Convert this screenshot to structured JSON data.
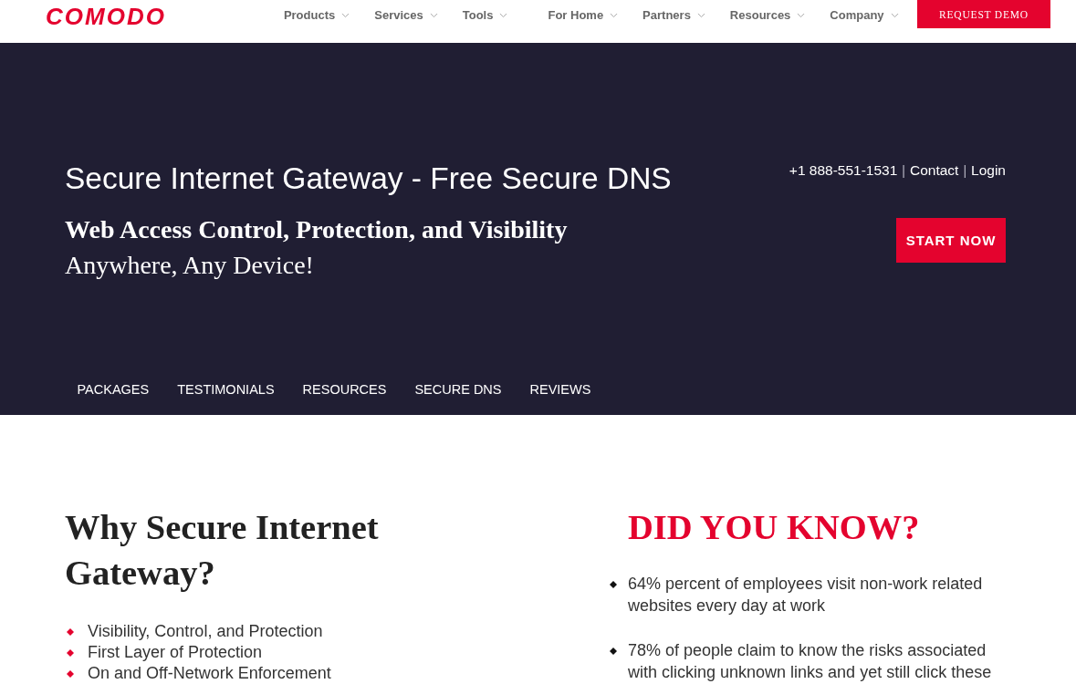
{
  "header": {
    "logo": "COMODO",
    "nav": [
      "Products",
      "Services",
      "Tools",
      "For Home",
      "Partners",
      "Resources",
      "Company"
    ],
    "cta": "REQUEST DEMO"
  },
  "hero": {
    "title": "Secure Internet Gateway - Free Secure DNS",
    "subtitle": "Web Access Control, Protection, and Visibility",
    "tagline": "Anywhere, Any Device!",
    "contact_bar": [
      {
        "kind": "link",
        "text": "+1 888-551-1531"
      },
      {
        "kind": "separator",
        "text": "|"
      },
      {
        "kind": "link",
        "text": "Contact"
      },
      {
        "kind": "separator",
        "text": "|"
      },
      {
        "kind": "link",
        "text": "Login"
      }
    ],
    "cta": "START NOW",
    "tabs": [
      "PACKAGES",
      "TESTIMONIALS",
      "RESOURCES",
      "SECURE DNS",
      "REVIEWS"
    ]
  },
  "why_section": {
    "title": "Why Secure Internet Gateway?",
    "items": [
      "Visibility, Control, and Protection",
      "First Layer of Protection",
      "On and Off-Network Enforcement"
    ]
  },
  "facts_section": {
    "title": "DID YOU KNOW?",
    "items": [
      "64% percent of employees visit non-work related websites every day at work",
      "78% of people claim to know the risks associated with clicking unknown links and yet still click these"
    ]
  }
}
